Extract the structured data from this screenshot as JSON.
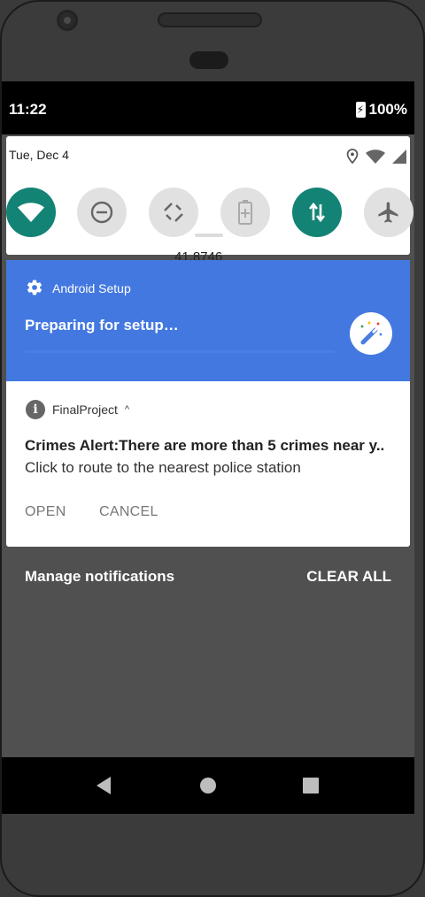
{
  "status_bar": {
    "time": "11:22",
    "battery": "100%"
  },
  "quick_settings": {
    "date": "Tue, Dec 4",
    "peek_text": "41.8746",
    "tiles": [
      {
        "name": "wifi",
        "state": "on"
      },
      {
        "name": "do-not-disturb",
        "state": "off"
      },
      {
        "name": "auto-rotate",
        "state": "off"
      },
      {
        "name": "battery-saver",
        "state": "off"
      },
      {
        "name": "mobile-data",
        "state": "on"
      },
      {
        "name": "airplane-mode",
        "state": "off"
      }
    ]
  },
  "notifications": [
    {
      "app": "Android Setup",
      "title": "Preparing for setup…",
      "progress": 0,
      "accent": "#4378e0"
    },
    {
      "app": "FinalProject",
      "title": "Crimes Alert:There are more than 5 crimes near y..",
      "text": "Click to route to the nearest police station",
      "actions": [
        "OPEN",
        "CANCEL"
      ]
    }
  ],
  "footer": {
    "manage": "Manage notifications",
    "clear_all": "CLEAR ALL"
  },
  "colors": {
    "tile_on": "#138376",
    "tile_off": "#e1e1e1",
    "setup_blue": "#4378e0"
  }
}
